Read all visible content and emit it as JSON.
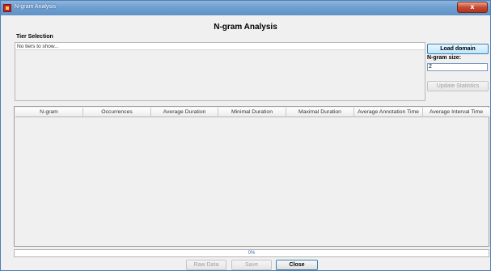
{
  "window": {
    "title": "N-gram Analysis",
    "close_glyph": "x"
  },
  "dialog": {
    "heading": "N-gram Analysis"
  },
  "tier_selection": {
    "label": "Tier Selection",
    "empty_text": "No tiers to show..."
  },
  "controls": {
    "load_domain_label": "Load domain",
    "ngram_size_label": "N-gram size:",
    "ngram_size_value": "2",
    "update_statistics_label": "Update Statistics"
  },
  "table": {
    "columns": [
      "N-gram",
      "Occurrences",
      "Average Duration",
      "Minimal Duration",
      "Maximal Duration",
      "Average Annotation Time",
      "Average Interval Time"
    ],
    "rows": []
  },
  "progress": {
    "value": 0,
    "label": "0%"
  },
  "footer": {
    "raw_data_label": "Raw Data",
    "save_label": "Save",
    "close_label": "Close"
  },
  "colors": {
    "titlebar": "#6f9fd0",
    "progress_text": "#3b5fb5",
    "close_button": "#c74a32"
  },
  "icons": {
    "app": "elan-app-icon",
    "close": "close-icon"
  }
}
